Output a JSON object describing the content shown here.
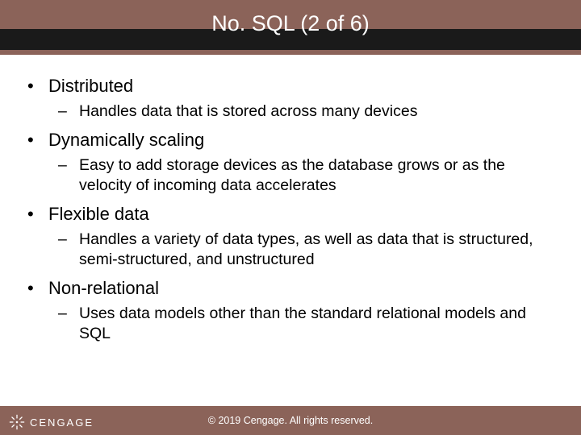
{
  "title": "No. SQL (2 of 6)",
  "bullets": [
    {
      "label": "Distributed",
      "sub": "Handles data that is stored across many devices"
    },
    {
      "label": "Dynamically scaling",
      "sub": "Easy to add storage devices as the database grows or as the velocity of incoming data accelerates"
    },
    {
      "label": "Flexible data",
      "sub": "Handles a variety of data types, as well as data that is structured, semi-structured, and unstructured"
    },
    {
      "label": "Non-relational",
      "sub": "Uses data models other than the standard relational models and SQL"
    }
  ],
  "footer": {
    "copyright": "© 2019 Cengage. All rights reserved.",
    "brand": "CENGAGE"
  }
}
